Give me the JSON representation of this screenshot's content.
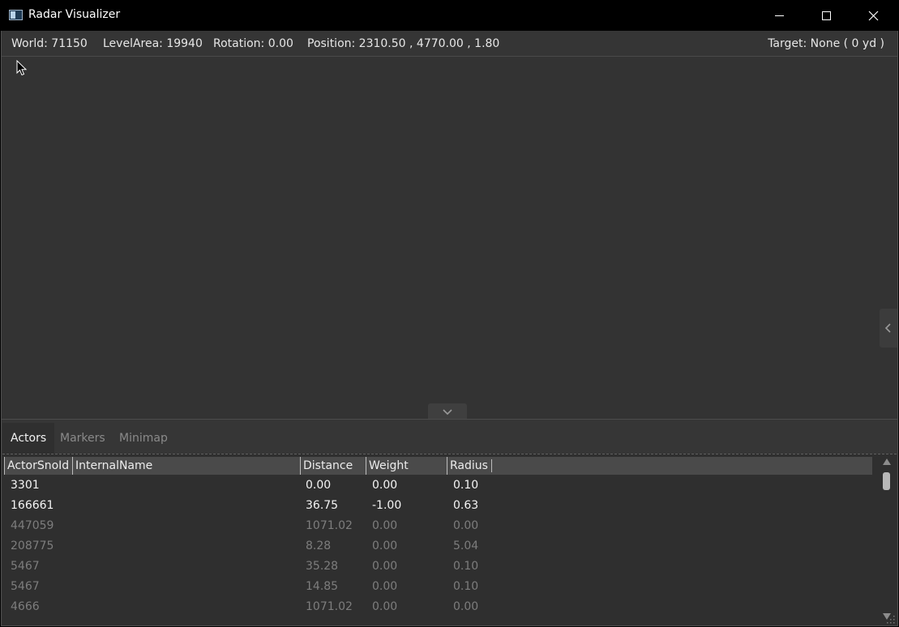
{
  "window": {
    "title": "Radar Visualizer",
    "icon": "app-window-icon"
  },
  "infobar": {
    "world": "World: 71150",
    "level_area": "LevelArea: 19940",
    "rotation": "Rotation: 0.00",
    "position": "Position: 2310.50 , 4770.00 , 1.80",
    "target": "Target: None ( 0 yd )"
  },
  "tabs": {
    "actors": "Actors",
    "markers": "Markers",
    "minimap": "Minimap",
    "selected": "Actors"
  },
  "grid": {
    "columns": [
      "ActorSnoId",
      "InternalName",
      "Distance",
      "Weight",
      "Radius"
    ],
    "rows": [
      {
        "id": "3301",
        "name": "",
        "distance": "0.00",
        "weight": "0.00",
        "radius": "0.10",
        "style": "bright"
      },
      {
        "id": "166661",
        "name": "",
        "distance": "36.75",
        "weight": "-1.00",
        "radius": "0.63",
        "style": "bright"
      },
      {
        "id": "447059",
        "name": "",
        "distance": "1071.02",
        "weight": "0.00",
        "radius": "0.00",
        "style": "dim"
      },
      {
        "id": "208775",
        "name": "",
        "distance": "8.28",
        "weight": "0.00",
        "radius": "5.04",
        "style": "dim"
      },
      {
        "id": "5467",
        "name": "",
        "distance": "35.28",
        "weight": "0.00",
        "radius": "0.10",
        "style": "dim"
      },
      {
        "id": "5467",
        "name": "",
        "distance": "14.85",
        "weight": "0.00",
        "radius": "0.10",
        "style": "dim"
      },
      {
        "id": "4666",
        "name": "",
        "distance": "1071.02",
        "weight": "0.00",
        "radius": "0.00",
        "style": "dim"
      }
    ]
  },
  "colors": {
    "background": "#333333",
    "titlebar": "#000000",
    "header": "#4a4a4a",
    "text_bright": "#f4f4f4",
    "text_dim": "#7d7d7d"
  },
  "icons": {
    "minimize": "minimize-icon",
    "maximize": "maximize-icon",
    "close": "close-icon",
    "side_panel": "chevron-left-icon",
    "bottom_panel": "chevron-down-icon"
  }
}
